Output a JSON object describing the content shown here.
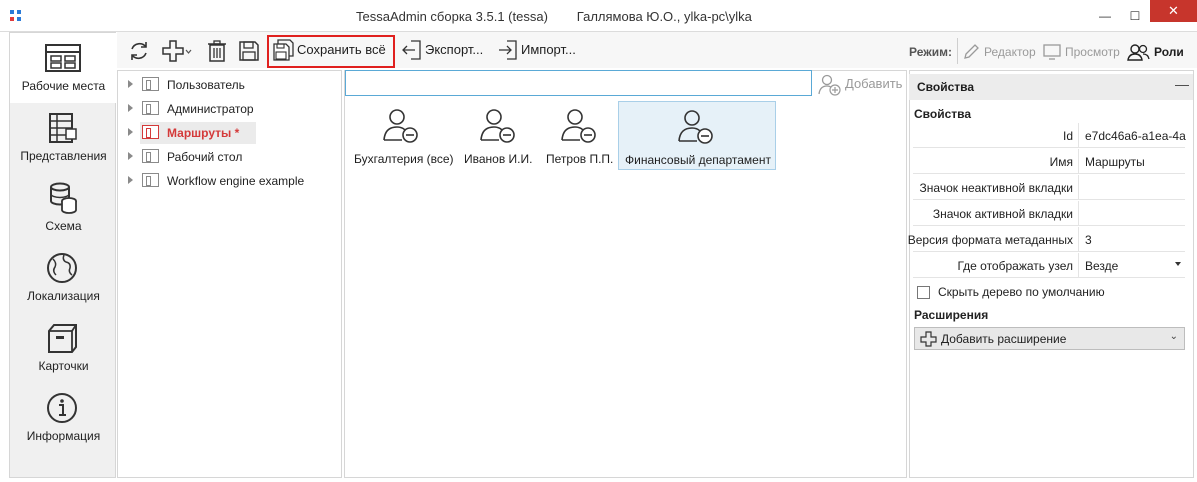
{
  "window": {
    "title": "TessaAdmin сборка 3.5.1 (tessa)        Галлямова Ю.О., ylka-pc\\ylka",
    "minimize": "—",
    "maximize": "☐",
    "close": "✕"
  },
  "nav": {
    "items": [
      {
        "label": "Рабочие места",
        "icon": "workplaces-icon",
        "active": true
      },
      {
        "label": "Представления",
        "icon": "views-icon"
      },
      {
        "label": "Схема",
        "icon": "database-icon"
      },
      {
        "label": "Локализация",
        "icon": "globe-icon"
      },
      {
        "label": "Карточки",
        "icon": "cards-icon"
      },
      {
        "label": "Информация",
        "icon": "info-icon"
      }
    ]
  },
  "toolbar": {
    "refresh_icon": "refresh-icon",
    "add_icon": "add-icon",
    "delete_icon": "delete-icon",
    "save_icon": "save-icon",
    "save_all_label": "Сохранить всё",
    "export_label": "Экспорт...",
    "import_label": "Импорт...",
    "mode_label": "Режим:",
    "modes": {
      "editor": "Редактор",
      "preview": "Просмотр",
      "roles": "Роли"
    },
    "highlight_color": "#e0201e"
  },
  "tree": {
    "items": [
      {
        "label": "Пользователь",
        "modified": false
      },
      {
        "label": "Администратор",
        "modified": false
      },
      {
        "label": "Маршруты  *",
        "modified": true
      },
      {
        "label": "Рабочий стол",
        "modified": false
      },
      {
        "label": "Workflow engine example",
        "modified": false
      }
    ]
  },
  "content": {
    "search_value": "",
    "add_label": "Добавить",
    "roles": [
      {
        "label": "Бухгалтерия (все)",
        "selected": false
      },
      {
        "label": "Иванов И.И.",
        "selected": false
      },
      {
        "label": "Петров П.П.",
        "selected": false
      },
      {
        "label": "Финансовый департамент",
        "selected": true
      }
    ]
  },
  "properties": {
    "header": "Свойства",
    "collapse": "—",
    "section_props": "Свойства",
    "rows": [
      {
        "key": "Id",
        "value": "e7dc46a6-a1ea-4a"
      },
      {
        "key": "Имя",
        "value": "Маршруты"
      },
      {
        "key": "Значок неактивной вкладки",
        "value": ""
      },
      {
        "key": "Значок активной вкладки",
        "value": ""
      },
      {
        "key": "Версия формата метаданных",
        "value": "3"
      },
      {
        "key": "Где отображать узел",
        "value": "Везде"
      }
    ],
    "hide_tree_label": "Скрыть дерево по умолчанию",
    "hide_tree_checked": false,
    "section_extensions": "Расширения",
    "add_extension_label": "Добавить расширение"
  }
}
